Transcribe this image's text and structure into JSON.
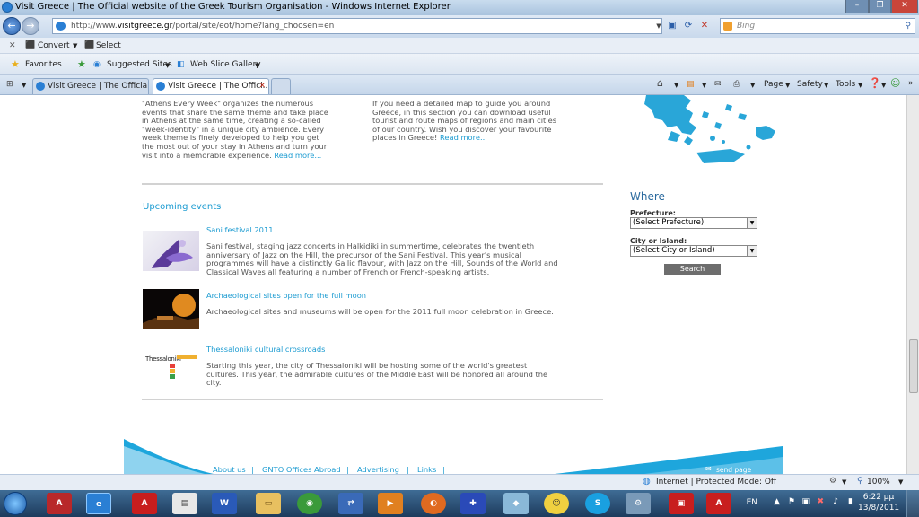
{
  "window": {
    "title": "Visit Greece | The Official website of the Greek Tourism Organisation - Windows Internet Explorer"
  },
  "address": {
    "url_prefix": "http://www.",
    "url_domain": "visitgreece.gr",
    "url_path": "/portal/site/eot/home?lang_choosen=en",
    "search_placeholder": "Bing"
  },
  "commandbar": {
    "convert_label": "Convert",
    "select_label": "Select"
  },
  "favbar": {
    "favorites_label": "Favorites",
    "suggested_label": "Suggested Sites",
    "webslice_label": "Web Slice Gallery"
  },
  "tabs": [
    {
      "label": "Visit Greece | The Official ..."
    },
    {
      "label": "Visit Greece | The Offici..."
    }
  ],
  "tools": {
    "page_label": "Page",
    "safety_label": "Safety",
    "tools_label": "Tools"
  },
  "content": {
    "athens_text": "\"Athens Every Week\" organizes the numerous events that share the same theme and take place in Athens at the same time, creating a so-called \"week-identity\" in a unique city ambience. Every week theme is finely developed to help you get the most out of your stay in Athens and turn your visit into a memorable experience.",
    "athens_more": "Read more...",
    "map_text": "If you need a detailed map to guide you around Greece, in this section you can download useful tourist and route maps of regions and main cities of our country. Wish you discover your favourite places in Greece!",
    "map_more": "Read more...",
    "upcoming_heading": "Upcoming events",
    "events": [
      {
        "title": "Sani festival 2011",
        "desc": "Sani festival, staging jazz concerts in Halkidiki in summertime, celebrates the twentieth anniversary of Jazz on the Hill, the precursor of the Sani Festival. This year's musical programmes will have a distinctly Gallic flavour, with Jazz on the Hill, Sounds of the World and Classical Waves all featuring a number of French or French-speaking artists."
      },
      {
        "title": "Archaeological sites open for the full moon",
        "desc": "Archaeological sites and museums will be open for the 2011 full moon celebration in Greece."
      },
      {
        "title": "Thessaloniki cultural crossroads",
        "desc": "Starting this year, the city of Thessaloniki will be hosting some of the world's greatest cultures. This year, the admirable cultures of the Middle East will be honored all around the city."
      }
    ],
    "thessaloniki_logo": "Thessaloniki",
    "where": {
      "heading": "Where",
      "prefecture_label": "Prefecture:",
      "prefecture_value": "(Select Prefecture)",
      "city_label": "City or Island:",
      "city_value": "(Select City or Island)",
      "search_label": "Search"
    },
    "footer": {
      "links": [
        "About us",
        "GNTO Offices Abroad",
        "Advertising",
        "Links"
      ],
      "send_page": "send page"
    }
  },
  "status": {
    "zone": "Internet | Protected Mode: Off",
    "zoom": "100%"
  },
  "taskbar": {
    "lang": "EN",
    "time": "6:22 μμ",
    "date": "13/8/2011"
  }
}
